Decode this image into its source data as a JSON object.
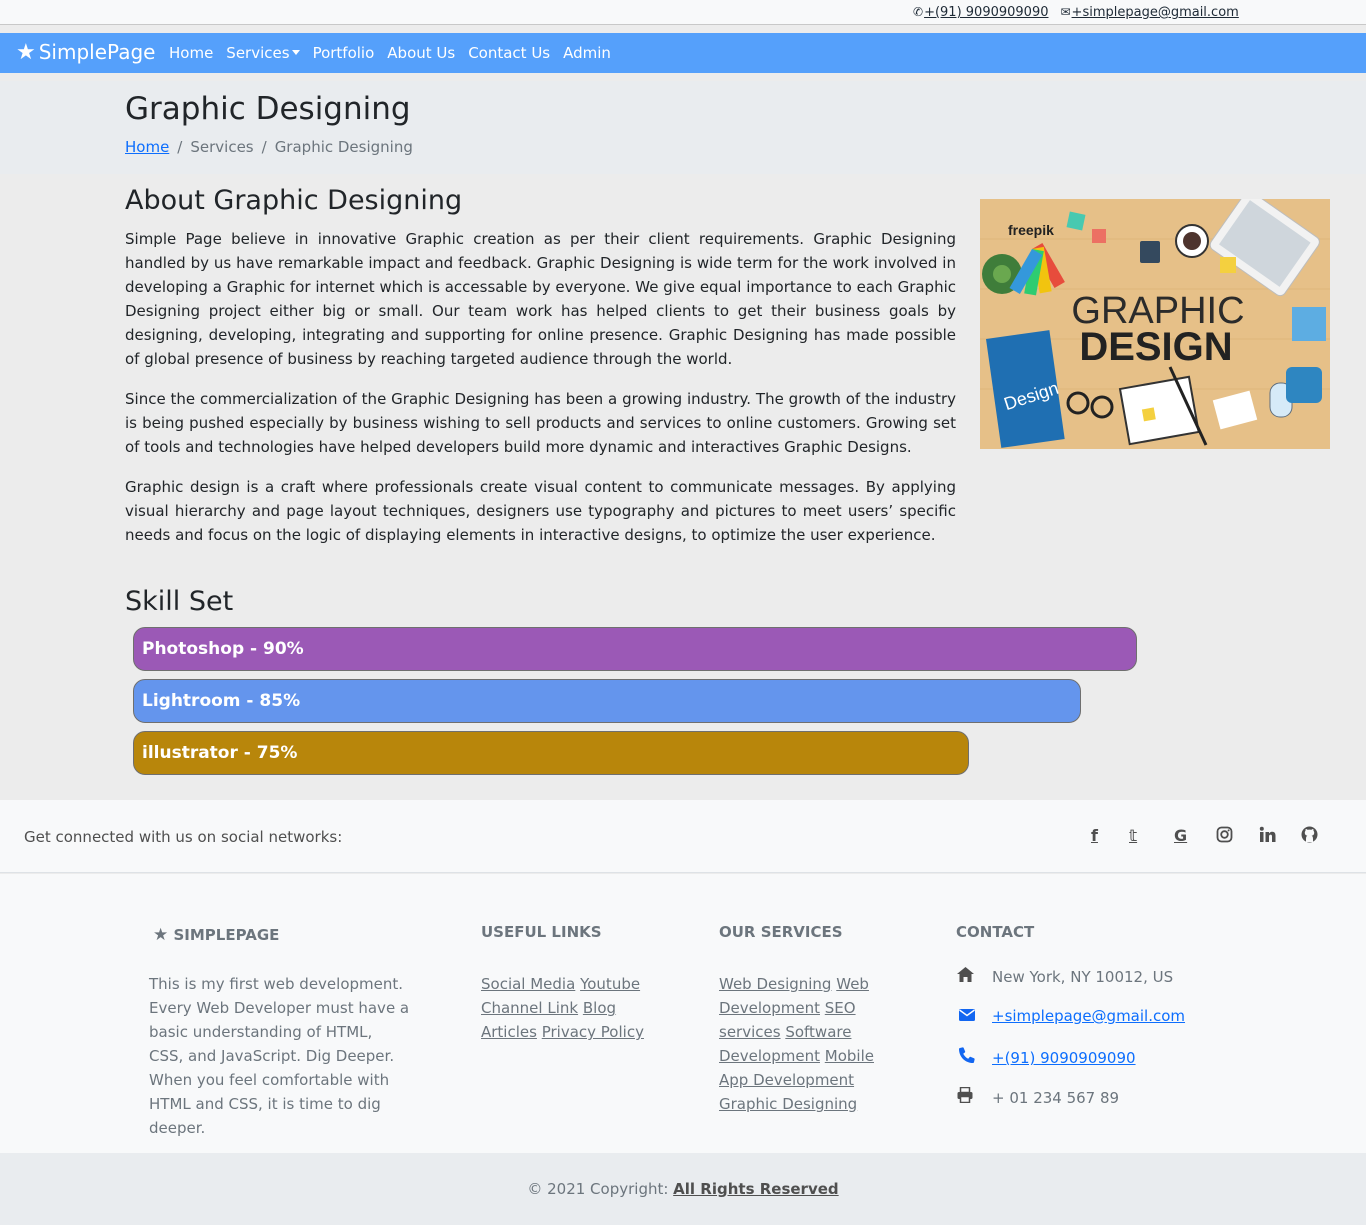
{
  "topbar": {
    "phone": "+(91) 9090909090",
    "email": "+simplepage@gmail.com"
  },
  "navbar": {
    "brand": "SimplePage",
    "items": [
      "Home",
      "Services",
      "Portfolio",
      "About Us",
      "Contact Us",
      "Admin"
    ],
    "bg_color": "#55a0fb"
  },
  "header": {
    "title": "Graphic Designing",
    "breadcrumb": [
      "Home",
      "Services",
      "Graphic Designing"
    ]
  },
  "about": {
    "title": "About Graphic Designing",
    "paragraphs": [
      "Simple Page believe in innovative Graphic creation as per their client requirements. Graphic Designing handled by us have remarkable impact and feedback. Graphic Designing is wide term for the work involved in developing a Graphic for internet which is accessable by everyone. We give equal importance to each Graphic Designing project either big or small. Our team work has helped clients to get their business goals by designing, developing, integrating and supporting for online presence. Graphic Designing has made possible of global presence of business by reaching targeted audience through the world.",
      "Since the commercialization of the Graphic Designing has been a growing industry. The growth of the industry is being pushed especially by business wishing to sell products and services to online customers. Growing set of tools and technologies have helped developers build more dynamic and interactives Graphic Designs.",
      "Graphic design is a craft where professionals create visual content to communicate messages. By applying visual hierarchy and page layout techniques, designers use typography and pictures to meet users’ specific needs and focus on the logic of displaying elements in interactive designs, to optimize the user experience."
    ],
    "image": {
      "logo_text": "freepik",
      "line1": "GRAPHIC",
      "line2": "DESIGN",
      "side_text": "Design"
    }
  },
  "skills": {
    "title": "Skill Set",
    "items": [
      {
        "label": "Photoshop - 90%",
        "percent": 90,
        "color": "#9b59b6"
      },
      {
        "label": "Lightroom - 85%",
        "percent": 85,
        "color": "#6495ed"
      },
      {
        "label": "illustrator - 75%",
        "percent": 75,
        "color": "#b8860b"
      }
    ]
  },
  "social": {
    "text": "Get connected with us on social networks:",
    "icons": [
      "facebook-icon",
      "twitter-icon",
      "google-icon",
      "instagram-icon",
      "linkedin-icon",
      "github-icon"
    ]
  },
  "footer": {
    "brand": "SIMPLEPAGE",
    "about": "This is my first web development. Every Web Developer must have a basic understanding of HTML, CSS, and JavaScript. Dig Deeper. When you feel comfortable with HTML and CSS, it is time to dig deeper.",
    "links_title": "Useful links",
    "links": [
      "Social Media",
      "Youtube Channel Link",
      "Blog Articles",
      "Privacy Policy"
    ],
    "services_title": "Our services",
    "services": [
      "Web Designing",
      "Web Development",
      "SEO services",
      "Software Development",
      "Mobile App Development",
      "Graphic Designing"
    ],
    "contact_title": "Contact",
    "address": "New York, NY 10012, US",
    "email": "+simplepage@gmail.com",
    "phone": "+(91) 9090909090",
    "fax": "+ 01 234 567 89"
  },
  "copyright": {
    "text": "© 2021 Copyright: ",
    "link": "All Rights Reserved"
  }
}
